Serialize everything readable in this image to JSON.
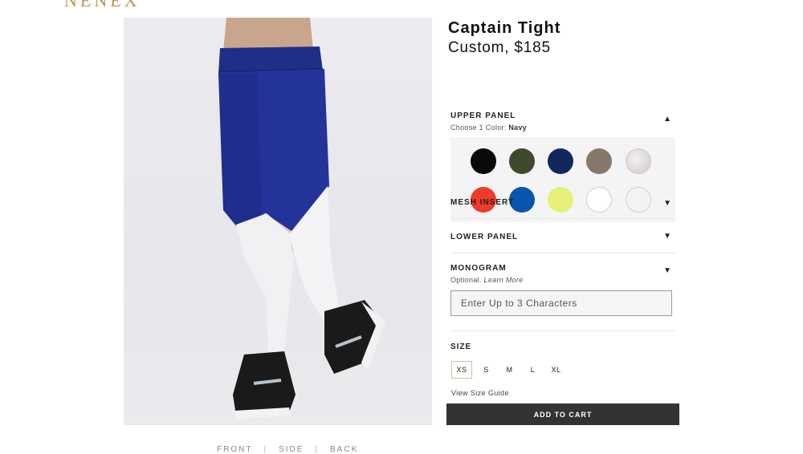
{
  "brand": {
    "logo_text": "NENEX"
  },
  "product": {
    "name": "Captain Tight",
    "price_line": "Custom, $185"
  },
  "views": {
    "front": "FRONT",
    "side": "SIDE",
    "back": "BACK",
    "separator": "|"
  },
  "upper_panel": {
    "heading": "UPPER PANEL",
    "choose_label": "Choose 1 Color:",
    "selected_color": "Navy",
    "swatches": [
      {
        "name": "black",
        "color": "#0a0a0a"
      },
      {
        "name": "olive",
        "color": "#3e4a2e"
      },
      {
        "name": "navy",
        "color": "#10285c"
      },
      {
        "name": "taupe",
        "color": "#86786a"
      },
      {
        "name": "marble",
        "color": "#d9d3d3"
      },
      {
        "name": "red",
        "color": "#f03a2a"
      },
      {
        "name": "blue",
        "color": "#0a54b0"
      },
      {
        "name": "lime",
        "color": "#e6f078"
      },
      {
        "name": "white",
        "color": "#ffffff"
      },
      {
        "name": "light-gray",
        "color": "#f3f3f3"
      }
    ]
  },
  "mesh_insert": {
    "heading": "MESH INSERT"
  },
  "lower_panel": {
    "heading": "LOWER PANEL"
  },
  "monogram": {
    "heading": "MONOGRAM",
    "optional": "Optional.",
    "learn_more": "Learn More",
    "placeholder": "Enter Up to 3 Characters"
  },
  "size": {
    "heading": "SIZE",
    "options": [
      "XS",
      "S",
      "M",
      "L",
      "XL"
    ],
    "selected": "XS",
    "guide": "View Size Guide"
  },
  "cart": {
    "label": "ADD TO CART"
  },
  "colors": {
    "accent_gold": "#b8945a",
    "button_dark": "#333333"
  }
}
